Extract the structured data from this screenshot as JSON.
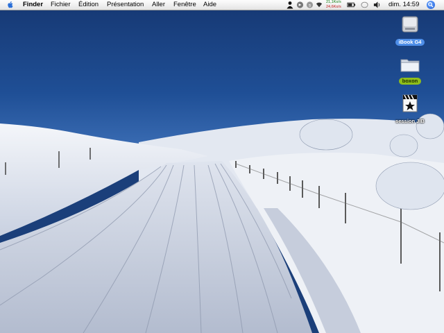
{
  "menubar": {
    "app_name": "Finder",
    "menus": [
      "Fichier",
      "Édition",
      "Présentation",
      "Aller",
      "Fenêtre",
      "Aide"
    ],
    "net_up": "21,1Ko/s",
    "net_down": "24,6Ko/s",
    "clock": "dim. 14:59",
    "extras": [
      "user-icon",
      "sync-icon",
      "status-icon",
      "wifi-icon",
      "battery-icon",
      "bluetooth-icon",
      "volume-icon",
      "spotlight-icon"
    ]
  },
  "desktop": {
    "wallpaper": "snowy-ski-trail",
    "icons": [
      {
        "label": "iBook G4",
        "icon": "hard-disk-icon"
      },
      {
        "label": "boxon",
        "icon": "folder-icon"
      },
      {
        "label": "session JIB",
        "icon": "clapper-document-icon"
      }
    ]
  },
  "colors": {
    "sky": "#1b3f7a",
    "snow": "#e8edf5",
    "label_blue": "#4e8ee8",
    "label_green": "#8fbe1a"
  }
}
